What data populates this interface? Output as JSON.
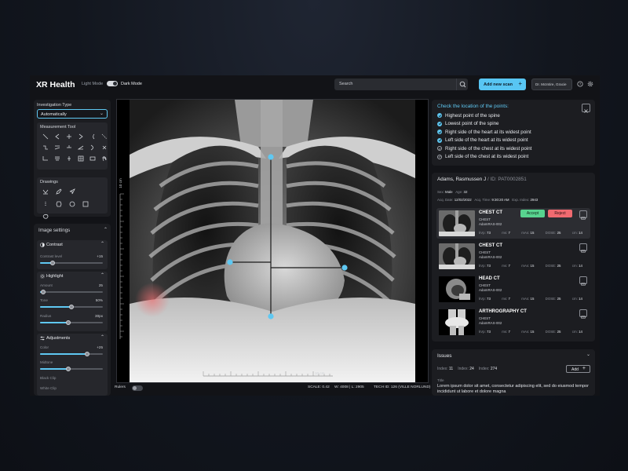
{
  "header": {
    "brand": "XR Health",
    "light_mode_label": "Light Mode",
    "dark_mode_label": "Dark Mode",
    "search_placeholder": "Search",
    "new_scan_label": "Add new scan",
    "user_label": "Dr. McIntire, Gracie",
    "icons": [
      "search-icon",
      "plus-icon",
      "help-icon",
      "gear-icon"
    ]
  },
  "left": {
    "investigation_type_label": "Investigation Type",
    "investigation_type_value": "Automatically",
    "measurement_tool_label": "Measurement Tool",
    "drawings_label": "Drawings",
    "image_settings_label": "Image settings",
    "contrast": {
      "label": "Contrast",
      "level_label": "Contrast level",
      "level_value": "+15",
      "level": 0.2
    },
    "highlight": {
      "label": "Highlight",
      "amount_label": "Amount",
      "amount_value": "25",
      "amount": 0.05,
      "tone_label": "Tone",
      "tone_value": "50%",
      "tone": 0.5,
      "radius_label": "Radius",
      "radius_value": "30px",
      "radius": 0.45
    },
    "adjustments": {
      "label": "Adjustments",
      "color_label": "Color",
      "color_value": "+25",
      "color": 0.75,
      "midtone_label": "Midtone",
      "midtone": 0.45,
      "black_clip_label": "Black Clip",
      "white_clip_label": "White Clip"
    }
  },
  "viewer": {
    "ruler_side_label": "10 cm",
    "ruler_bottom_label": "10 cm",
    "rulers_label": "Rulers",
    "scale": "SCALE: 0.42",
    "wl": "W: 4008 | L: 2905",
    "tech": "TECH ID: 126 (VILLE NORLUND)"
  },
  "checklist": {
    "title": "Check the location of the points:",
    "items": [
      {
        "text": "Highest point of the spine",
        "done": true
      },
      {
        "text": "Lowest point of the spine",
        "done": true
      },
      {
        "text": "Right side of the heart at its widest point",
        "done": true
      },
      {
        "text": "Left side of the heart at its widest point",
        "done": true
      },
      {
        "text": "Right side of the chest at its widest point",
        "done": false
      },
      {
        "text": "Left side of the chest at its widest point",
        "done": false
      }
    ]
  },
  "patient": {
    "name": "Adams, Rasmussen J",
    "id": "/ ID: PAT0002851",
    "sex_label": "Sex:",
    "sex": "Male",
    "age_label": "Age:",
    "age": "32",
    "acq_date_label": "Acq. Date:",
    "acq_date": "12/02/2022",
    "acq_time_label": "Acq. Time:",
    "acq_time": "9:30:20 AM",
    "exp_index_label": "Exp. Index:",
    "exp_index": "2943"
  },
  "studies": [
    {
      "title": "CHEST CT",
      "body": "CHEST",
      "device": "AdamRAS-002",
      "kvp": "73",
      "ms": "7",
      "mas": "15",
      "dose": "25",
      "cm": "14",
      "active": true,
      "accept": "Accept",
      "reject": "Reject"
    },
    {
      "title": "CHEST CT",
      "body": "CHEST",
      "device": "AdamRAS-002",
      "kvp": "73",
      "ms": "7",
      "mas": "15",
      "dose": "25",
      "cm": "14",
      "active": false
    },
    {
      "title": "HEAD CT",
      "body": "CHEST",
      "device": "AdamRAS-002",
      "kvp": "73",
      "ms": "7",
      "mas": "15",
      "dose": "25",
      "cm": "14",
      "active": false
    },
    {
      "title": "ARTHROGRAPHY CT",
      "body": "CHEST",
      "device": "AdamRAS-002",
      "kvp": "73",
      "ms": "7",
      "mas": "15",
      "dose": "25",
      "cm": "14",
      "active": false
    }
  ],
  "param_labels": {
    "kvp": "kVp:",
    "ms": "ms:",
    "mas": "mAs:",
    "dose": "DOSE:",
    "cm": "cm:"
  },
  "issues": {
    "title": "Issues",
    "index_label": "Index:",
    "idx1": "11",
    "idx2": "24",
    "idx3": "274",
    "add_label": "Add",
    "title_label": "Title",
    "text": "Lorem ipsum dolor sit amet, consectetur adipiscing elit, sed do eiusmod tempor incididunt ut labore et dolore magna"
  },
  "colors": {
    "accent": "#5fc8f2",
    "accept": "#58d38f",
    "reject": "#f06a70",
    "panel": "#1c1d21"
  }
}
